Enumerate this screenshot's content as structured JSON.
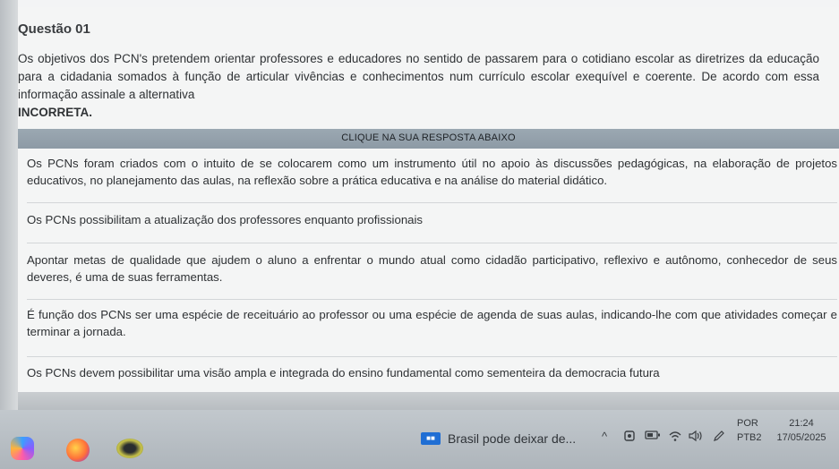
{
  "question": {
    "title": "Questão 01",
    "text_intro": "Os objetivos dos PCN's pretendem orientar professores e educadores no sentido de passarem para o cotidiano escolar as diretrizes da educação para a cidadania somados à função de articular vivências e conhecimentos num currículo escolar exequível e coerente. De acordo com essa informação assinale a alternativa",
    "text_emphasis": "INCORRETA."
  },
  "banner": {
    "label": "CLIQUE NA SUA RESPOSTA ABAIXO"
  },
  "answers": [
    "Os PCNs foram criados com o intuito de se colocarem como um instrumento útil no apoio às discussões pedagógicas, na elaboração de projetos educativos, no planejamento das aulas, na reflexão sobre a prática educativa e na análise do material didático.",
    "Os PCNs possibilitam a atualização dos professores enquanto profissionais",
    "Apontar metas de qualidade que ajudem o aluno a enfrentar o mundo atual como cidadão participativo, reflexivo e autônomo, conhecedor de seus deveres, é uma de suas ferramentas.",
    "É função dos PCNs ser uma espécie de receituário ao professor ou uma espécie de agenda de suas aulas, indicando-lhe com que atividades começar e terminar a jornada.",
    "Os PCNs devem possibilitar uma visão ampla e integrada do ensino fundamental como sementeira da democracia futura"
  ],
  "taskbar": {
    "news_text": "Brasil pode deixar de...",
    "tray_icons": [
      "chevron-up-icon",
      "camera-icon",
      "battery-icon",
      "wifi-icon",
      "volume-icon",
      "pen-icon"
    ],
    "language": "POR",
    "keyboard": "PTB2",
    "time": "21:24",
    "date": "17/05/2025"
  }
}
